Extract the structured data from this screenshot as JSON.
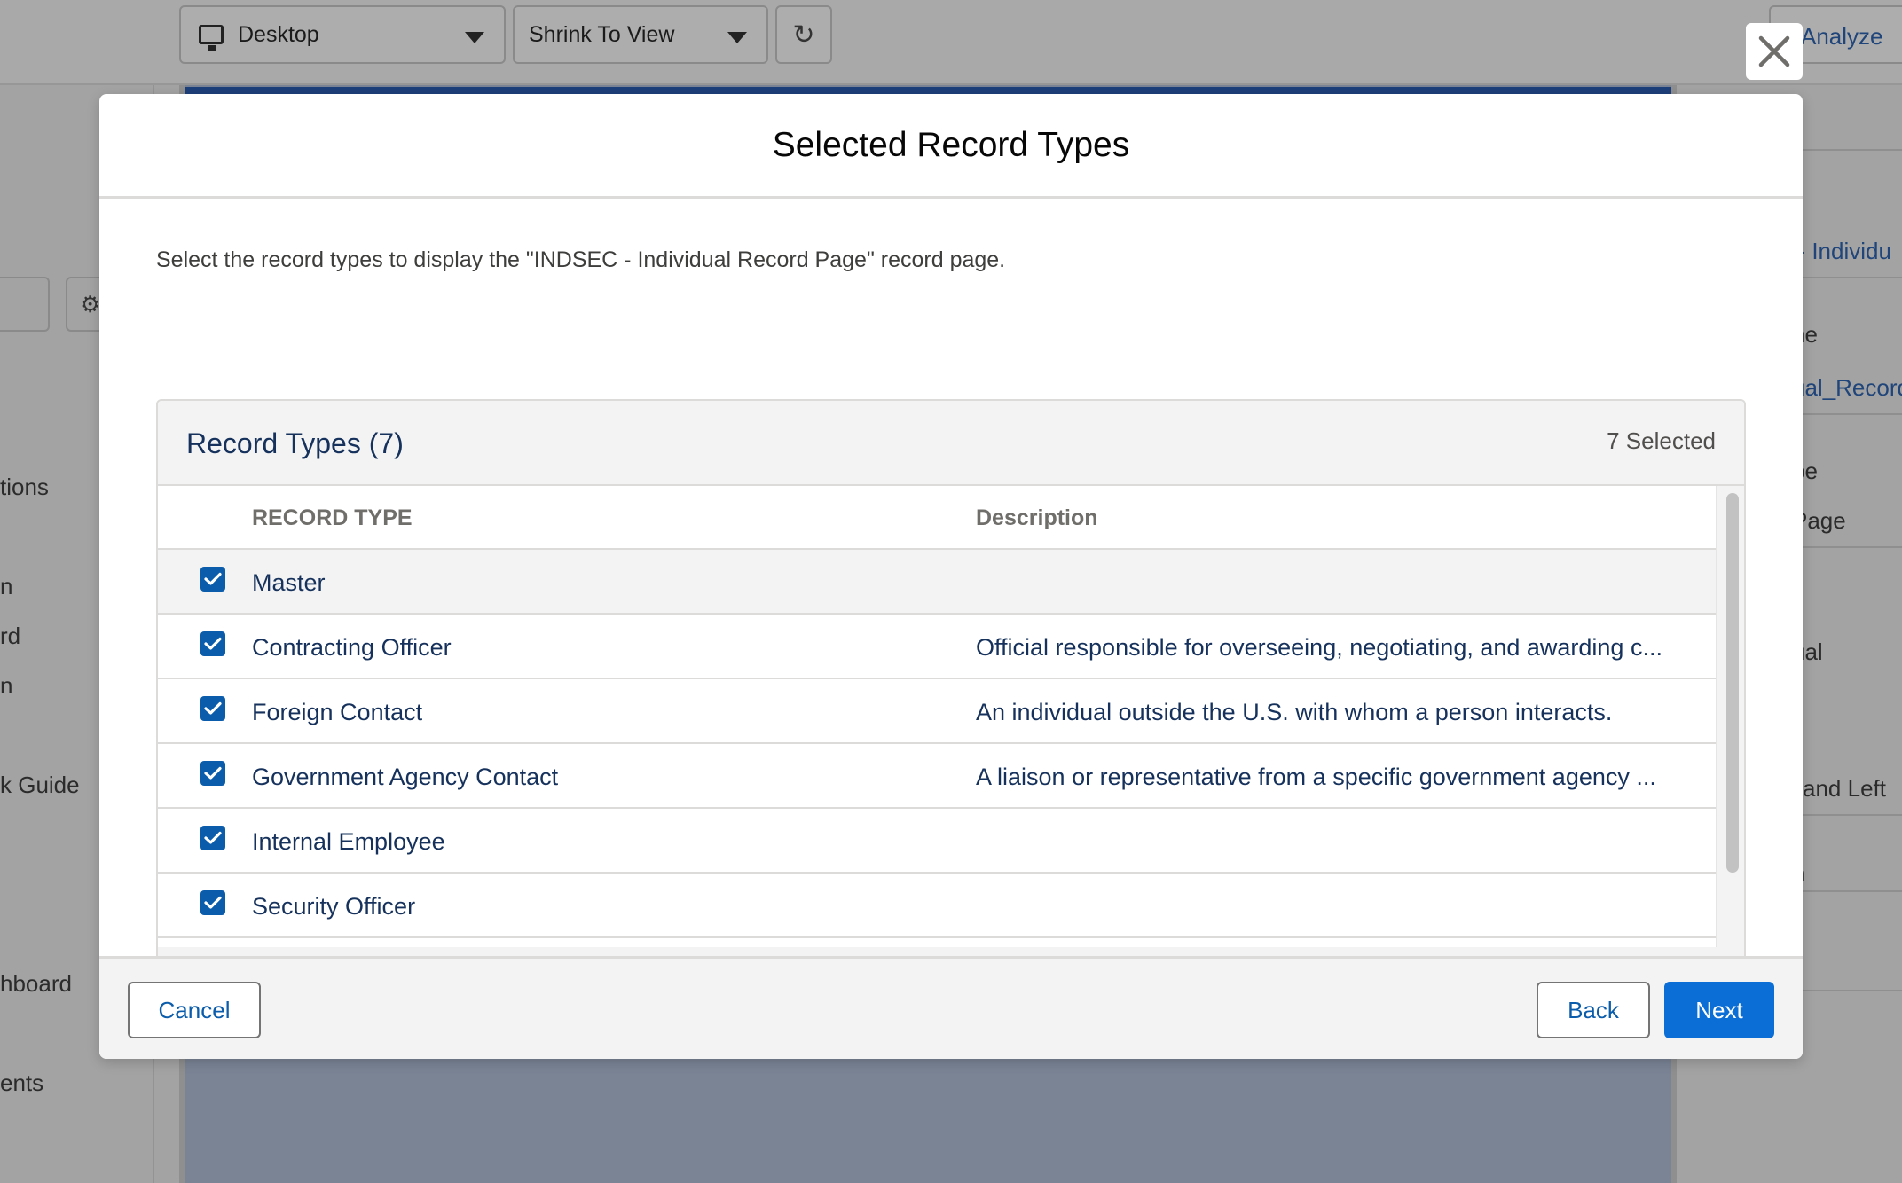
{
  "toolbar": {
    "device_select": "Desktop",
    "zoom_select": "Shrink To View",
    "refresh_icon": "refresh-icon",
    "analyze_label": "Analyze"
  },
  "left_panel": {
    "items": [
      "tions",
      "n",
      "rd",
      "n",
      "k Guide",
      "hboard",
      "ents"
    ]
  },
  "right_panel": {
    "items": [
      ": - Individu",
      "ne",
      "ual_Record",
      "pe",
      "Page",
      "ual",
      "and Left",
      "n"
    ]
  },
  "modal": {
    "title": "Selected Record Types",
    "instructions": "Select the record types to display the \"INDSEC - Individual Record Page\" record page.",
    "card_title": "Record Types (7)",
    "selected_count": "7 Selected",
    "columns": {
      "record_type": "RECORD TYPE",
      "description": "Description"
    },
    "rows": [
      {
        "name": "Master",
        "description": "",
        "checked": true
      },
      {
        "name": "Contracting Officer",
        "description": "Official responsible for overseeing, negotiating, and awarding c...",
        "checked": true
      },
      {
        "name": "Foreign Contact",
        "description": "An individual outside the U.S. with whom a person interacts.",
        "checked": true
      },
      {
        "name": "Government Agency Contact",
        "description": "A liaison or representative from a specific government agency ...",
        "checked": true
      },
      {
        "name": "Internal Employee",
        "description": "",
        "checked": true
      },
      {
        "name": "Security Officer",
        "description": "",
        "checked": true
      }
    ],
    "cancel_label": "Cancel",
    "back_label": "Back",
    "next_label": "Next"
  },
  "colors": {
    "brand": "#0b6ed6",
    "checkbox": "#0b5cab",
    "title_text": "#16325c"
  }
}
